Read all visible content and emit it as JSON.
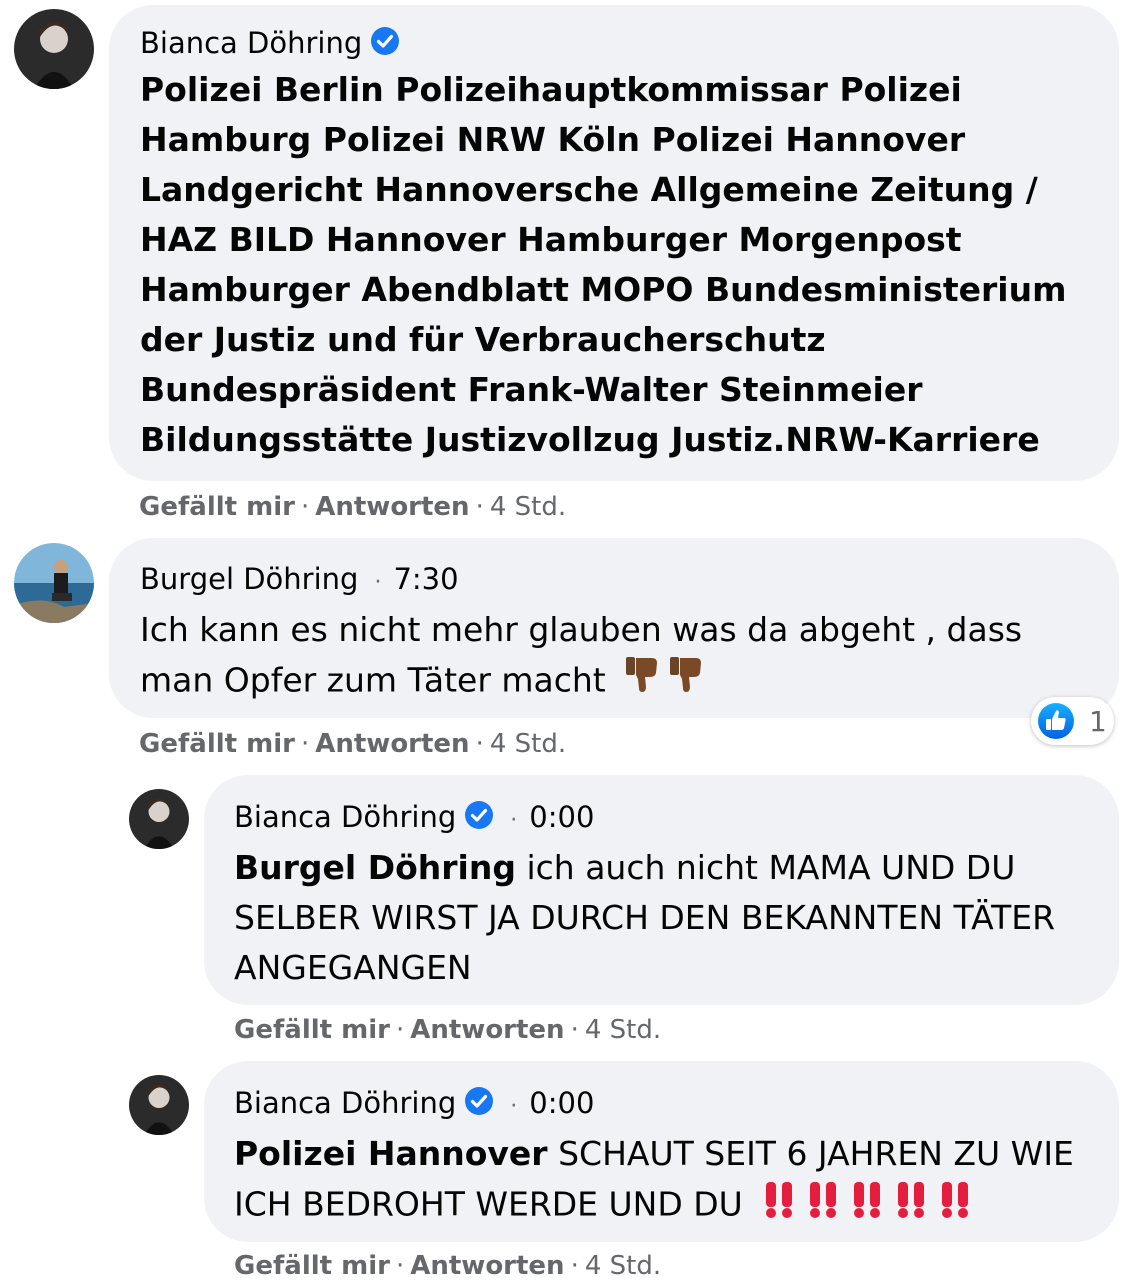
{
  "comments": [
    {
      "author": "Bianca Döhring",
      "verified": true,
      "time": "",
      "body": "Polizei Berlin Polizeihauptkommissar Polizei Hamburg Polizei NRW Köln Polizei Hannover Landgericht Hannoversche Allgemeine Zeitung / HAZ BILD Hannover Hamburger Morgenpost Hamburger Abendblatt MOPO Bundesministerium der Justiz und für Verbraucherschutz Bundespräsident Frank-Walter Steinmeier Bildungsstätte Justizvollzug Justiz.NRW-Karriere",
      "actions": {
        "like": "Gefällt mir",
        "reply": "Antworten",
        "age": "4 Std."
      }
    },
    {
      "author": "Burgel Döhring",
      "verified": false,
      "time": "7:30",
      "body": "Ich kann es nicht mehr glauben was da abgeht , dass man Opfer zum Täter macht",
      "emojis": [
        "thumbs-down-icon",
        "thumbs-down-icon"
      ],
      "reactions": {
        "icon": "like-icon",
        "count": "1"
      },
      "actions": {
        "like": "Gefällt mir",
        "reply": "Antworten",
        "age": "4 Std."
      }
    },
    {
      "author": "Bianca Döhring",
      "verified": true,
      "time": "0:00",
      "mention": "Burgel Döhring",
      "body": "ich auch nicht MAMA UND DU SELBER WIRST JA DURCH DEN BEKANNTEN TÄTER ANGEGANGEN",
      "actions": {
        "like": "Gefällt mir",
        "reply": "Antworten",
        "age": "4 Std."
      }
    },
    {
      "author": "Bianca Döhring",
      "verified": true,
      "time": "0:00",
      "mention": "Polizei Hannover",
      "body": "SCHAUT SEIT 6 JAHREN ZU WIE ICH BEDROHT WERDE UND DU",
      "emojis": [
        "double-exclamation-icon",
        "double-exclamation-icon",
        "double-exclamation-icon",
        "double-exclamation-icon",
        "double-exclamation-icon"
      ],
      "actions": {
        "like": "Gefällt mir",
        "reply": "Antworten",
        "age": "4 Std."
      }
    }
  ],
  "separator": "·",
  "colors": {
    "bubble": "#f0f2f5",
    "verified": "#1877f2",
    "meta": "#65676b",
    "exclamation": "#e41e3f"
  }
}
